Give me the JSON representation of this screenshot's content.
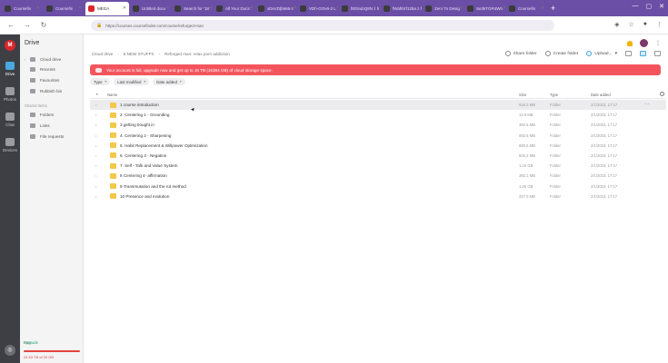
{
  "browser": {
    "tabs": [
      {
        "label": "Coursefin",
        "active": false
      },
      {
        "label": "Coursefin",
        "active": false
      },
      {
        "label": "MEGA",
        "active": true
      },
      {
        "label": "Untitled docu",
        "active": false
      },
      {
        "label": "Search for '18",
        "active": false
      },
      {
        "label": "All Your Docs",
        "active": false
      },
      {
        "label": "xDsVD|b666-z",
        "active": false
      },
      {
        "label": "VDh-GOv6-2 L",
        "active": false
      },
      {
        "label": "f8G6ubQ8N z h",
        "active": false
      },
      {
        "label": "fWaf6Xf12ba z h",
        "active": false
      },
      {
        "label": "Zero To Desig",
        "active": false
      },
      {
        "label": "Se3kTGR4Wn",
        "active": false
      },
      {
        "label": "Coursefin",
        "active": false
      }
    ],
    "url_host": "https://",
    "url": "https://courses.coursefinder.com/course/refurged-man"
  },
  "rail": {
    "items": [
      {
        "label": "Drive",
        "active": true
      },
      {
        "label": "Photos",
        "active": false
      },
      {
        "label": "Chat",
        "active": false
      },
      {
        "label": "Devices",
        "active": false
      }
    ]
  },
  "sidebar": {
    "title": "Drive",
    "items": [
      {
        "label": "Cloud drive"
      },
      {
        "label": "Recents"
      },
      {
        "label": "Favourites"
      },
      {
        "label": "Rubbish bin"
      }
    ],
    "shared_section": "Shared items",
    "shared_items": [
      {
        "label": "Folders"
      },
      {
        "label": "Links"
      },
      {
        "label": "File requests"
      }
    ],
    "storage": {
      "label": "Free",
      "upgrade": "Upgrade",
      "fraction_used": 1.0,
      "used_text": "24.53 TB of 20 GB"
    }
  },
  "main": {
    "breadcrumb": [
      "Cloud drive",
      "5 NEW STUFFS",
      "Reforged man: relax porn addiction"
    ],
    "actions": {
      "share": "Share folder",
      "create": "Create folder",
      "upload": "Upload..."
    },
    "alert": "Your account is full, upgrade now and get up to 16 TB (16384 GB) of cloud storage space.",
    "filters": [
      "Type",
      "Last modified",
      "Date added"
    ],
    "columns": {
      "name": "Name",
      "size": "Size",
      "type": "Type",
      "date": "Date added"
    },
    "rows": [
      {
        "name": "1 course introduction",
        "size": "918.3 MB",
        "type": "Folder",
        "date": "2/1/2023, 17:17",
        "highlight": true
      },
      {
        "name": "2. Centering 1 - Grounding",
        "size": "12.9 MB",
        "type": "Folder",
        "date": "2/1/2023, 17:17",
        "highlight": false
      },
      {
        "name": "3 getting bought in",
        "size": "382.5 MB",
        "type": "Folder",
        "date": "2/1/2023, 17:17",
        "highlight": false
      },
      {
        "name": "4. Centering 2 - Sharpening",
        "size": "502.5 MB",
        "type": "Folder",
        "date": "2/1/2023, 17:17",
        "highlight": false
      },
      {
        "name": "5. Habit Replacement & Willpower Optimization",
        "size": "680.5 MB",
        "type": "Folder",
        "date": "2/1/2023, 17:17",
        "highlight": false
      },
      {
        "name": "6. Centering 3 - Negation",
        "size": "503.2 MB",
        "type": "Folder",
        "date": "2/1/2023, 17:17",
        "highlight": false
      },
      {
        "name": "7. Self - Talk and Value System",
        "size": "1.15 GB",
        "type": "Folder",
        "date": "2/1/2023, 17:17",
        "highlight": false
      },
      {
        "name": "8 Centering 4- affirmation",
        "size": "383.1 MB",
        "type": "Folder",
        "date": "2/1/2023, 17:17",
        "highlight": false
      },
      {
        "name": "9 Transmutation and the rut method",
        "size": "1.25 GB",
        "type": "Folder",
        "date": "2/1/2023, 17:17",
        "highlight": false
      },
      {
        "name": "10 Presence and evolution",
        "size": "327.0 MB",
        "type": "Folder",
        "date": "2/1/2023, 17:17",
        "highlight": false
      }
    ]
  }
}
